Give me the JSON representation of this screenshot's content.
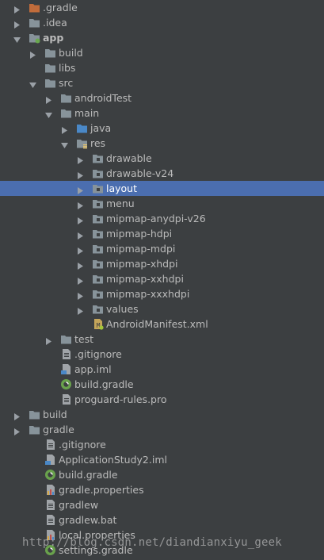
{
  "colors": {
    "background": "#3c3f41",
    "selection": "#4b6eaf",
    "text": "#bbbbbb",
    "folder": "#87939a",
    "folder_gradle": "#c16c3b",
    "folder_src": "#4a88c7"
  },
  "tree": [
    {
      "label": ".gradle",
      "depth": 0,
      "state": "collapsed",
      "icon": "folder-gradle-icon"
    },
    {
      "label": ".idea",
      "depth": 0,
      "state": "collapsed",
      "icon": "folder-icon"
    },
    {
      "label": "app",
      "depth": 0,
      "state": "expanded",
      "icon": "module-folder-icon",
      "bold": true
    },
    {
      "label": "build",
      "depth": 1,
      "state": "collapsed",
      "icon": "folder-icon"
    },
    {
      "label": "libs",
      "depth": 1,
      "state": "none",
      "icon": "folder-icon"
    },
    {
      "label": "src",
      "depth": 1,
      "state": "expanded",
      "icon": "folder-icon"
    },
    {
      "label": "androidTest",
      "depth": 2,
      "state": "collapsed",
      "icon": "folder-icon"
    },
    {
      "label": "main",
      "depth": 2,
      "state": "expanded",
      "icon": "folder-icon"
    },
    {
      "label": "java",
      "depth": 3,
      "state": "collapsed",
      "icon": "source-folder-icon"
    },
    {
      "label": "res",
      "depth": 3,
      "state": "expanded",
      "icon": "resource-folder-icon"
    },
    {
      "label": "drawable",
      "depth": 4,
      "state": "collapsed",
      "icon": "package-folder-icon"
    },
    {
      "label": "drawable-v24",
      "depth": 4,
      "state": "collapsed",
      "icon": "package-folder-icon"
    },
    {
      "label": "layout",
      "depth": 4,
      "state": "collapsed",
      "icon": "package-folder-icon",
      "selected": true
    },
    {
      "label": "menu",
      "depth": 4,
      "state": "collapsed",
      "icon": "package-folder-icon"
    },
    {
      "label": "mipmap-anydpi-v26",
      "depth": 4,
      "state": "collapsed",
      "icon": "package-folder-icon"
    },
    {
      "label": "mipmap-hdpi",
      "depth": 4,
      "state": "collapsed",
      "icon": "package-folder-icon"
    },
    {
      "label": "mipmap-mdpi",
      "depth": 4,
      "state": "collapsed",
      "icon": "package-folder-icon"
    },
    {
      "label": "mipmap-xhdpi",
      "depth": 4,
      "state": "collapsed",
      "icon": "package-folder-icon"
    },
    {
      "label": "mipmap-xxhdpi",
      "depth": 4,
      "state": "collapsed",
      "icon": "package-folder-icon"
    },
    {
      "label": "mipmap-xxxhdpi",
      "depth": 4,
      "state": "collapsed",
      "icon": "package-folder-icon"
    },
    {
      "label": "values",
      "depth": 4,
      "state": "collapsed",
      "icon": "package-folder-icon"
    },
    {
      "label": "AndroidManifest.xml",
      "depth": 4,
      "state": "none",
      "icon": "android-manifest-icon"
    },
    {
      "label": "test",
      "depth": 2,
      "state": "collapsed",
      "icon": "folder-icon"
    },
    {
      "label": ".gitignore",
      "depth": 2,
      "state": "none",
      "icon": "text-file-icon"
    },
    {
      "label": "app.iml",
      "depth": 2,
      "state": "none",
      "icon": "iml-file-icon"
    },
    {
      "label": "build.gradle",
      "depth": 2,
      "state": "none",
      "icon": "gradle-file-icon"
    },
    {
      "label": "proguard-rules.pro",
      "depth": 2,
      "state": "none",
      "icon": "text-file-icon"
    },
    {
      "label": "build",
      "depth": 0,
      "state": "collapsed",
      "icon": "folder-icon"
    },
    {
      "label": "gradle",
      "depth": 0,
      "state": "collapsed",
      "icon": "folder-icon"
    },
    {
      "label": ".gitignore",
      "depth": 1,
      "state": "none",
      "icon": "text-file-icon"
    },
    {
      "label": "ApplicationStudy2.iml",
      "depth": 1,
      "state": "none",
      "icon": "iml-file-icon"
    },
    {
      "label": "build.gradle",
      "depth": 1,
      "state": "none",
      "icon": "gradle-file-icon"
    },
    {
      "label": "gradle.properties",
      "depth": 1,
      "state": "none",
      "icon": "properties-file-icon"
    },
    {
      "label": "gradlew",
      "depth": 1,
      "state": "none",
      "icon": "text-file-icon"
    },
    {
      "label": "gradlew.bat",
      "depth": 1,
      "state": "none",
      "icon": "text-file-icon"
    },
    {
      "label": "local.properties",
      "depth": 1,
      "state": "none",
      "icon": "properties-file-icon"
    },
    {
      "label": "settings.gradle",
      "depth": 1,
      "state": "none",
      "icon": "gradle-file-icon"
    }
  ],
  "watermark": "http://blog.csdn.net/diandianxiyu_geek"
}
